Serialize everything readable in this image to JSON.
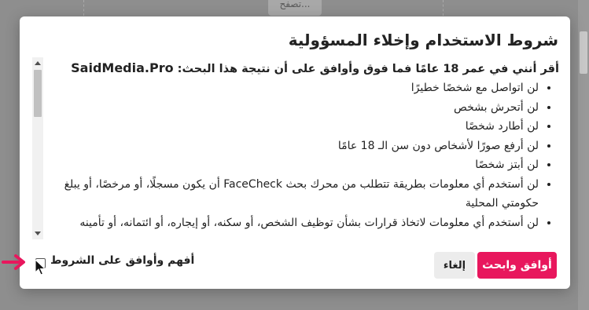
{
  "background": {
    "browse_button_label": "تصفح..."
  },
  "dialog": {
    "title": "شروط الاستخدام وإخلاء المسؤولية",
    "intro_text": "أقر أنني في عمر 18 عامًا فما فوق وأوافق على أن نتيجة هذا البحث:",
    "intro_brand": "SaidMedia.Pro",
    "terms": [
      "لن اتواصل مع شخصًا خطيرًا",
      "لن أتحرش بشخص",
      "لن أطارد شخصًا",
      "لن أرفع صورًا لأشخاص دون سن الـ 18 عامًا",
      "لن أبتز شخصًا",
      "لن أستخدم أي معلومات بطريقة تتطلب من محرك بحث FaceCheck أن يكون مسجلًا، أو مرخصًا، أو يبلغ حكومتي المحلية",
      "لن أستخدم أي معلومات لاتخاذ قرارات بشأن توظيف الشخص، أو سكنه، أو إيجاره، أو ائتمانه، أو تأمينه"
    ],
    "agree_checkbox_label": "أفهم وأوافق على الشروط",
    "cancel_label": "إلغاء",
    "agree_search_label": "أوافق وابحث"
  },
  "colors": {
    "accent": "#e8175d",
    "overlay": "#8e8e8e",
    "annotation_arrow": "#e8175d"
  },
  "icons": {
    "annotation": "arrow-right-icon",
    "cursor": "mouse-pointer-icon"
  }
}
